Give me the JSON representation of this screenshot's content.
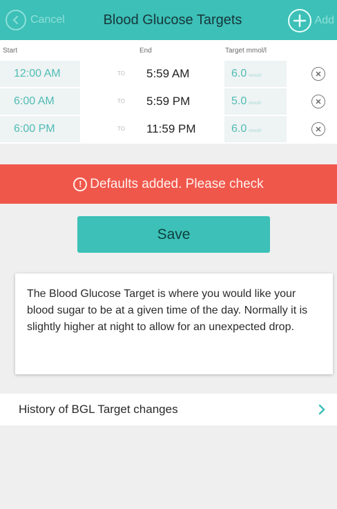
{
  "header": {
    "cancel_label": "Cancel",
    "title": "Blood Glucose Targets",
    "add_label": "Add"
  },
  "columns": {
    "start": "Start",
    "end": "End",
    "target": "Target mmol/l"
  },
  "rows": [
    {
      "start": "12:00 AM",
      "to": "TO",
      "end": "5:59 AM",
      "target": "6.0",
      "unit": "mmol/l"
    },
    {
      "start": "6:00 AM",
      "to": "TO",
      "end": "5:59 PM",
      "target": "5.0",
      "unit": "mmol/l"
    },
    {
      "start": "6:00 PM",
      "to": "TO",
      "end": "11:59 PM",
      "target": "6.0",
      "unit": "mmol/l"
    }
  ],
  "alert": {
    "text": "Defaults added. Please check"
  },
  "save_label": "Save",
  "info_text": "The Blood Glucose Target is where you would like your blood sugar to be at a given time of the day. Normally it is slightly higher at night to allow for an unexpected drop.",
  "history_label": "History of BGL Target changes",
  "colors": {
    "accent": "#3cc0b7",
    "alert": "#f0574b",
    "link_teal": "#4fbcb5"
  }
}
